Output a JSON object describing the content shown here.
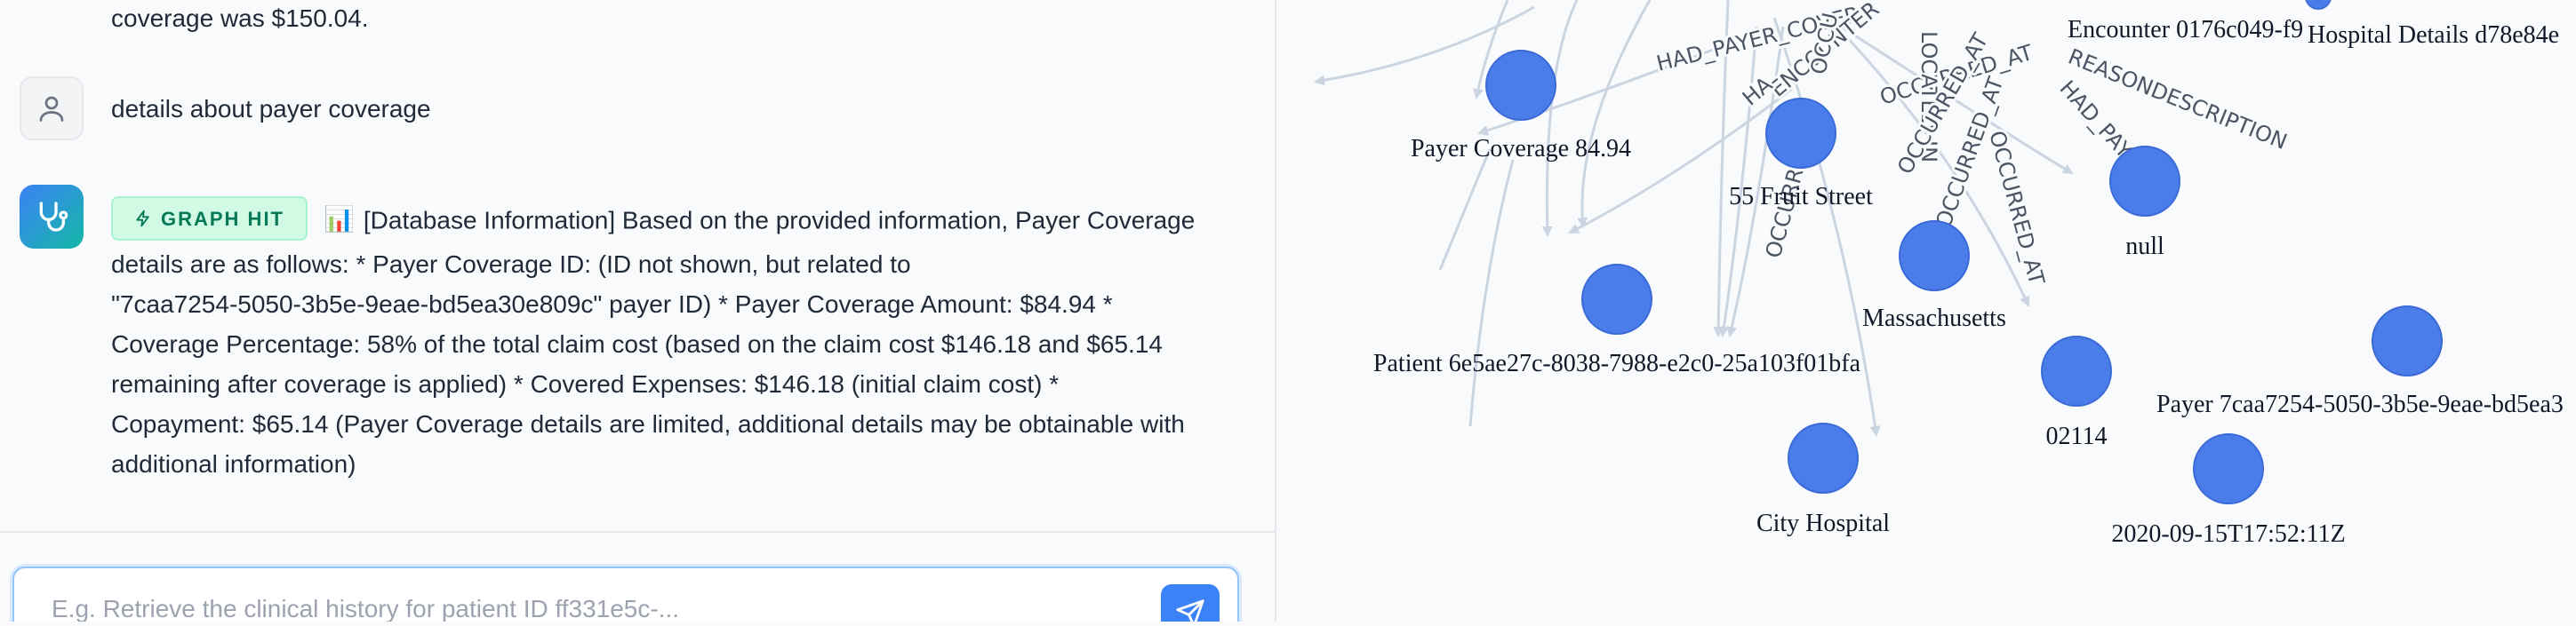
{
  "chat": {
    "previous_tail": "coverage was $150.04.",
    "user_message": "details about payer coverage",
    "bot_message": {
      "badge_label": "GRAPH HIT",
      "emoji": "📊",
      "line1": "[Database Information] Based on the provided information, Payer Coverage",
      "line2": "details are as follows: * Payer Coverage ID: (ID not shown, but related to",
      "line3": "\"7caa7254-5050-3b5e-9eae-bd5ea30e809c\" payer ID) * Payer Coverage Amount: $84.94 *",
      "line4": "Coverage Percentage: 58% of the total claim cost (based on the claim cost $146.18 and $65.14",
      "line5": "remaining after coverage is applied) * Covered Expenses: $146.18 (initial claim cost) *",
      "line6": "Copayment: $65.14 (Payer Coverage details are limited, additional details may be obtainable with",
      "line7": "additional information)"
    },
    "composer": {
      "placeholder": "E.g. Retrieve the clinical history for patient ID ff331e5c-..."
    }
  },
  "graph": {
    "edge_labels": {
      "had_payer_coverage": "HAD_PAYER_COVERA",
      "encounter": "ENCOUNTER",
      "occurred_at_a": "OCCURRED_AT",
      "located_in": "LOCATED_IN",
      "occurred_at_b": "OCCURRED_AT",
      "occurred_at_c": "OCCURRED_AT",
      "occurred_at_d": "OCCURRED_AT",
      "reasondescription": "REASONDESCRIPTION",
      "had_payer": "HAD_PAYER",
      "occu": "OCCU",
      "occurred_at_e": "OCCURRED_AT",
      "ha": "HA"
    },
    "nodes": {
      "encounter": "Encounter 0176c049-f9",
      "hospital_details": "Hospital Details d78e84e",
      "payer_coverage": "Payer Coverage 84.94",
      "address": "55 Fruit Street",
      "state": "Massachusetts",
      "null_node": "null",
      "patient": "Patient 6e5ae27c-8038-7988-e2c0-25a103f01bfa",
      "zip": "02114",
      "payer": "Payer 7caa7254-5050-3b5e-9eae-bd5ea3",
      "city_hospital": "City Hospital",
      "timestamp": "2020-09-15T17:52:11Z"
    },
    "colors": {
      "node_fill": "#4a7de9",
      "edge": "#cbd5e1"
    }
  }
}
